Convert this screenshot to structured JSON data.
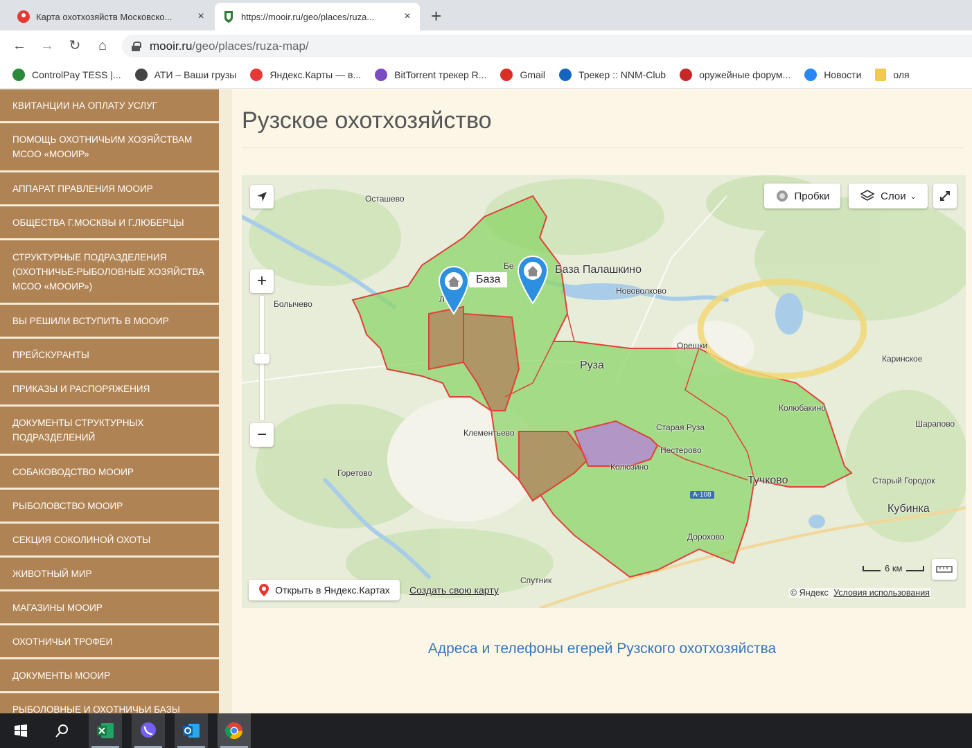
{
  "browser": {
    "tabs": [
      {
        "title": "Карта охотхозяйств Московско...",
        "close": "×"
      },
      {
        "title": "https://mooir.ru/geo/places/ruza...",
        "close": "×"
      }
    ],
    "new_tab": "+",
    "url_host": "mooir.ru",
    "url_path": "/geo/places/ruza-map/",
    "bookmarks": [
      {
        "label": "ControlPay TESS |...",
        "icon": "controlpay-icon",
        "color": "#2a8a3a"
      },
      {
        "label": "АТИ – Ваши грузы",
        "icon": "ati-icon",
        "color": "#444444"
      },
      {
        "label": "Яндекс.Карты — в...",
        "icon": "yandex-maps-icon",
        "color": "#e53935"
      },
      {
        "label": "BitTorrent трекер R...",
        "icon": "bittorrent-icon",
        "color": "#7b4bc4"
      },
      {
        "label": "Gmail",
        "icon": "gmail-icon",
        "color": "#d93025"
      },
      {
        "label": "Трекер :: NNM-Club",
        "icon": "nnm-icon",
        "color": "#1565c0"
      },
      {
        "label": "оружейные форум...",
        "icon": "forum-icon",
        "color": "#c62828"
      },
      {
        "label": "Новости",
        "icon": "vk-icon",
        "color": "#2787f5"
      },
      {
        "label": "оля",
        "icon": "folder-icon",
        "color": "#f2c94c"
      }
    ]
  },
  "sidebar": {
    "items": [
      {
        "label": "КВИТАНЦИИ НА ОПЛАТУ УСЛУГ"
      },
      {
        "label": "ПОМОЩЬ ОХОТНИЧЬИМ ХОЗЯЙСТВАМ МСОО «МООиР»"
      },
      {
        "label": "АППАРАТ ПРАВЛЕНИЯ МООиР"
      },
      {
        "label": "ОБЩЕСТВА г.МОСКВЫ И г.ЛЮБЕРЦЫ"
      },
      {
        "label": "СТРУКТУРНЫЕ ПОДРАЗДЕЛЕНИЯ (ОХОТНИЧЬЕ-РЫБОЛОВНЫЕ ХОЗЯЙСТВА МСОО «МООиР»)"
      },
      {
        "label": "ВЫ РЕШИЛИ ВСТУПИТЬ В МООиР"
      },
      {
        "label": "ПРЕЙСКУРАНТЫ"
      },
      {
        "label": "ПРИКАЗЫ И РАСПОРЯЖЕНИЯ"
      },
      {
        "label": "ДОКУМЕНТЫ СТРУКТУРНЫХ ПОДРАЗДЕЛЕНИЙ"
      },
      {
        "label": "СОБАКОВОДСТВО МООиР"
      },
      {
        "label": "РЫБОЛОВСТВО МООиР"
      },
      {
        "label": "СЕКЦИЯ СОКОЛИНОЙ ОХОТЫ"
      },
      {
        "label": "ЖИВОТНЫЙ МИР"
      },
      {
        "label": "МАГАЗИНЫ МООиР"
      },
      {
        "label": "ОХОТНИЧЬИ ТРОФЕИ"
      },
      {
        "label": "ДОКУМЕНТЫ МООиР"
      },
      {
        "label": "РЫБОЛОВНЫЕ И ОХОТНИЧЬИ БАЗЫ"
      }
    ]
  },
  "main": {
    "title": "Рузское охотхозяйство",
    "link_text": "Адреса и телефоны егерей Рузского охотхозяйства"
  },
  "map": {
    "controls": {
      "traffic": "Пробки",
      "layers": "Слои",
      "zoom_in": "+",
      "zoom_out": "−",
      "open_in_yandex": "Открыть в Яндекс.Картах",
      "create_map": "Создать свою карту",
      "scale": "6 км",
      "copyright": "© Яндекс",
      "terms": "Условия использования"
    },
    "pins": [
      {
        "label": "База"
      },
      {
        "label": "База Палашкино"
      }
    ],
    "places": {
      "ostashevo": "Осташево",
      "bolychevo": "Болычево",
      "novovolkovo": "Нововолково",
      "oreshki": "Орешки",
      "ruza": "Руза",
      "karinskoe": "Каринское",
      "kolyubakino": "Колюбакино",
      "sharapovo": "Шарапово",
      "staraya_ruza": "Старая Руза",
      "nesterovo": "Нестерово",
      "klementyevo": "Клементьево",
      "goretovo": "Горетово",
      "tuchkovo": "Тучково",
      "stary_gorodok": "Старый Городок",
      "kubinka": "Кубинка",
      "dorokhovo": "Дорохово",
      "kolyuzino": "Колюзино",
      "sputnik": "Спутник",
      "a108": "А-108",
      "be": "Бе",
      "lo": "Ло"
    }
  },
  "taskbar": {
    "items": [
      "windows-start-icon",
      "search-icon",
      "excel-icon",
      "viber-icon",
      "outlook-icon",
      "chrome-icon"
    ]
  }
}
